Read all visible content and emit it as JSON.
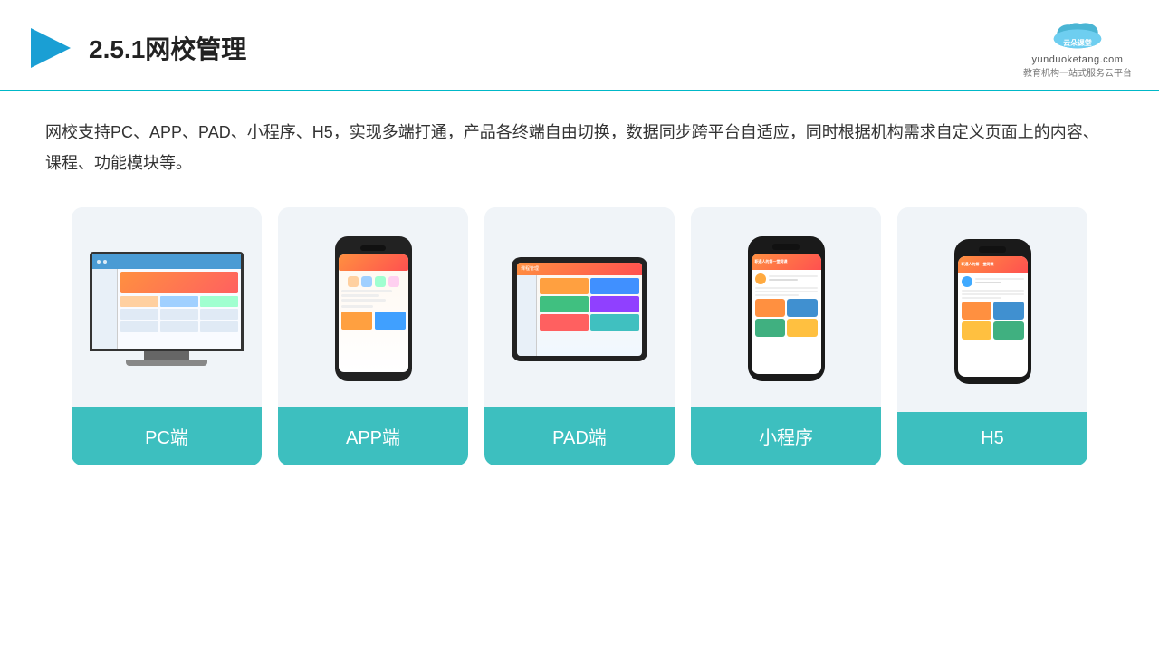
{
  "header": {
    "title": "2.5.1网校管理",
    "logo_name": "云朵课堂",
    "logo_url": "yunduoketang.com",
    "logo_tagline": "教育机构一站式服务云平台"
  },
  "description": "网校支持PC、APP、PAD、小程序、H5，实现多端打通，产品各终端自由切换，数据同步跨平台自适应，同时根据机构需求自定义页面上的内容、课程、功能模块等。",
  "cards": [
    {
      "id": "pc",
      "label": "PC端"
    },
    {
      "id": "app",
      "label": "APP端"
    },
    {
      "id": "pad",
      "label": "PAD端"
    },
    {
      "id": "mini",
      "label": "小程序"
    },
    {
      "id": "h5",
      "label": "H5"
    }
  ],
  "colors": {
    "accent": "#3dbfbf",
    "header_line": "#00b8c8",
    "card_bg": "#eef2f7",
    "card_label_bg": "#3dbfbf"
  }
}
